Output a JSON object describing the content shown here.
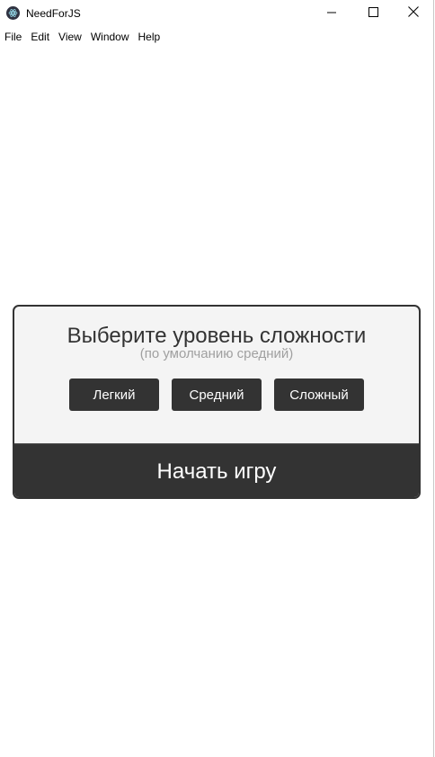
{
  "window": {
    "title": "NeedForJS",
    "icon": "electron-atom-icon",
    "controls": {
      "minimize_icon": "minimize-icon",
      "maximize_icon": "maximize-icon",
      "close_icon": "close-icon"
    }
  },
  "menu": {
    "items": [
      "File",
      "Edit",
      "View",
      "Window",
      "Help"
    ]
  },
  "dialog": {
    "title": "Выберите уровень сложности",
    "subtitle": "(по умолчанию средний)",
    "levels": [
      {
        "label": "Легкий"
      },
      {
        "label": "Средний"
      },
      {
        "label": "Сложный"
      }
    ],
    "start_label": "Начать игру"
  },
  "colors": {
    "dark": "#333333",
    "panel": "#f4f4f4",
    "subtitle": "#a0a0a0",
    "button_text": "#ffffff"
  }
}
